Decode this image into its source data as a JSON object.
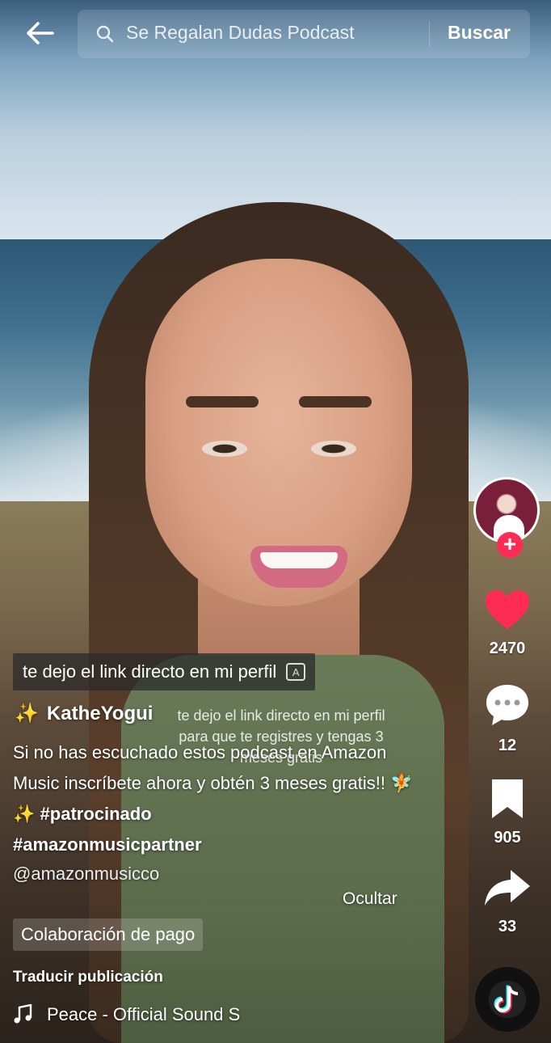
{
  "header": {
    "search_query": "Se Regalan Dudas Podcast",
    "search_button": "Buscar",
    "back_icon": "arrow-left-icon",
    "search_icon": "magnifier-icon"
  },
  "video": {
    "burned_caption": "te dejo el link directo en mi perfil",
    "caption_badge": "A",
    "overlay_subtitle": "te dejo el link directo en mi perfil para que te registres y tengas 3 meses gratis"
  },
  "actions": {
    "likes": "2470",
    "comments": "12",
    "bookmarks": "905",
    "shares": "33",
    "like_color": "#fe2c55",
    "follow_color": "#fe2c55"
  },
  "post": {
    "author": "KatheYogui",
    "author_prefix": "✨",
    "description_line": "Si no has escuchado estos podcast en Amazon Music inscríbete ahora y obtén 3 meses gratis!! 🧚 ✨",
    "hashtag1": "#patrocinado",
    "hashtag2": "#amazonmusicpartner",
    "mention": "@amazonmusicco",
    "hide_label": "Ocultar",
    "paid_label": "Colaboración de pago",
    "translate_label": "Traducir publicación",
    "sound_label": "Peace - Official Sound S"
  }
}
